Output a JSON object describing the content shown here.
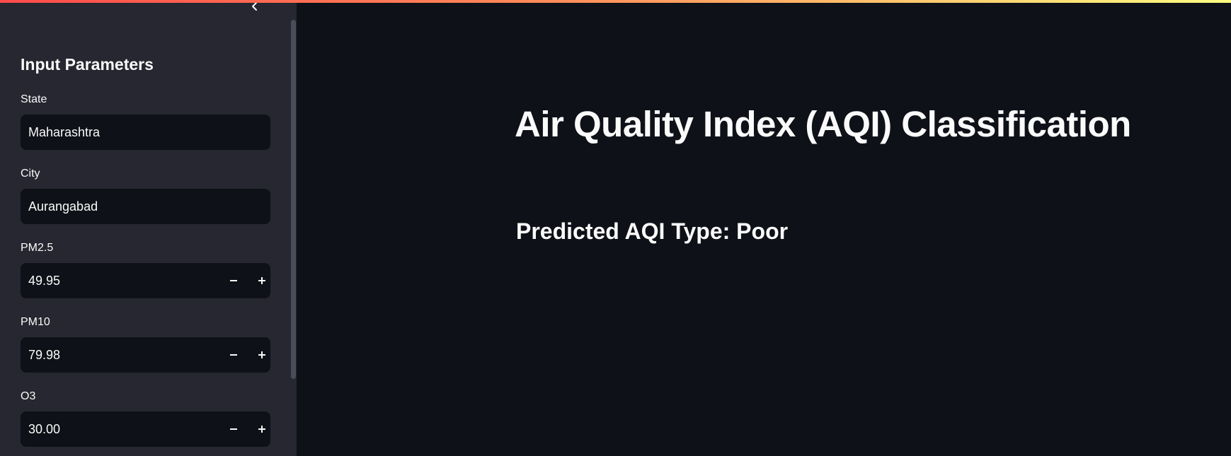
{
  "sidebar": {
    "heading": "Input Parameters",
    "fields": [
      {
        "label": "State",
        "value": "Maharashtra"
      },
      {
        "label": "City",
        "value": "Aurangabad"
      },
      {
        "label": "PM2.5",
        "value": "49.95"
      },
      {
        "label": "PM10",
        "value": "79.98"
      },
      {
        "label": "O3",
        "value": "30.00"
      }
    ]
  },
  "main": {
    "title": "Air Quality Index (AQI) Classification",
    "prediction_label": "Predicted AQI Type:",
    "prediction_value": "Poor"
  },
  "icons": {
    "collapse": "chevron-left-icon",
    "decrement": "minus-icon",
    "increment": "plus-icon"
  },
  "colors": {
    "background": "#0e1117",
    "sidebar": "#262730",
    "text": "#fafafa",
    "accent_start": "#ff4b4b",
    "accent_end": "#fffd80"
  }
}
